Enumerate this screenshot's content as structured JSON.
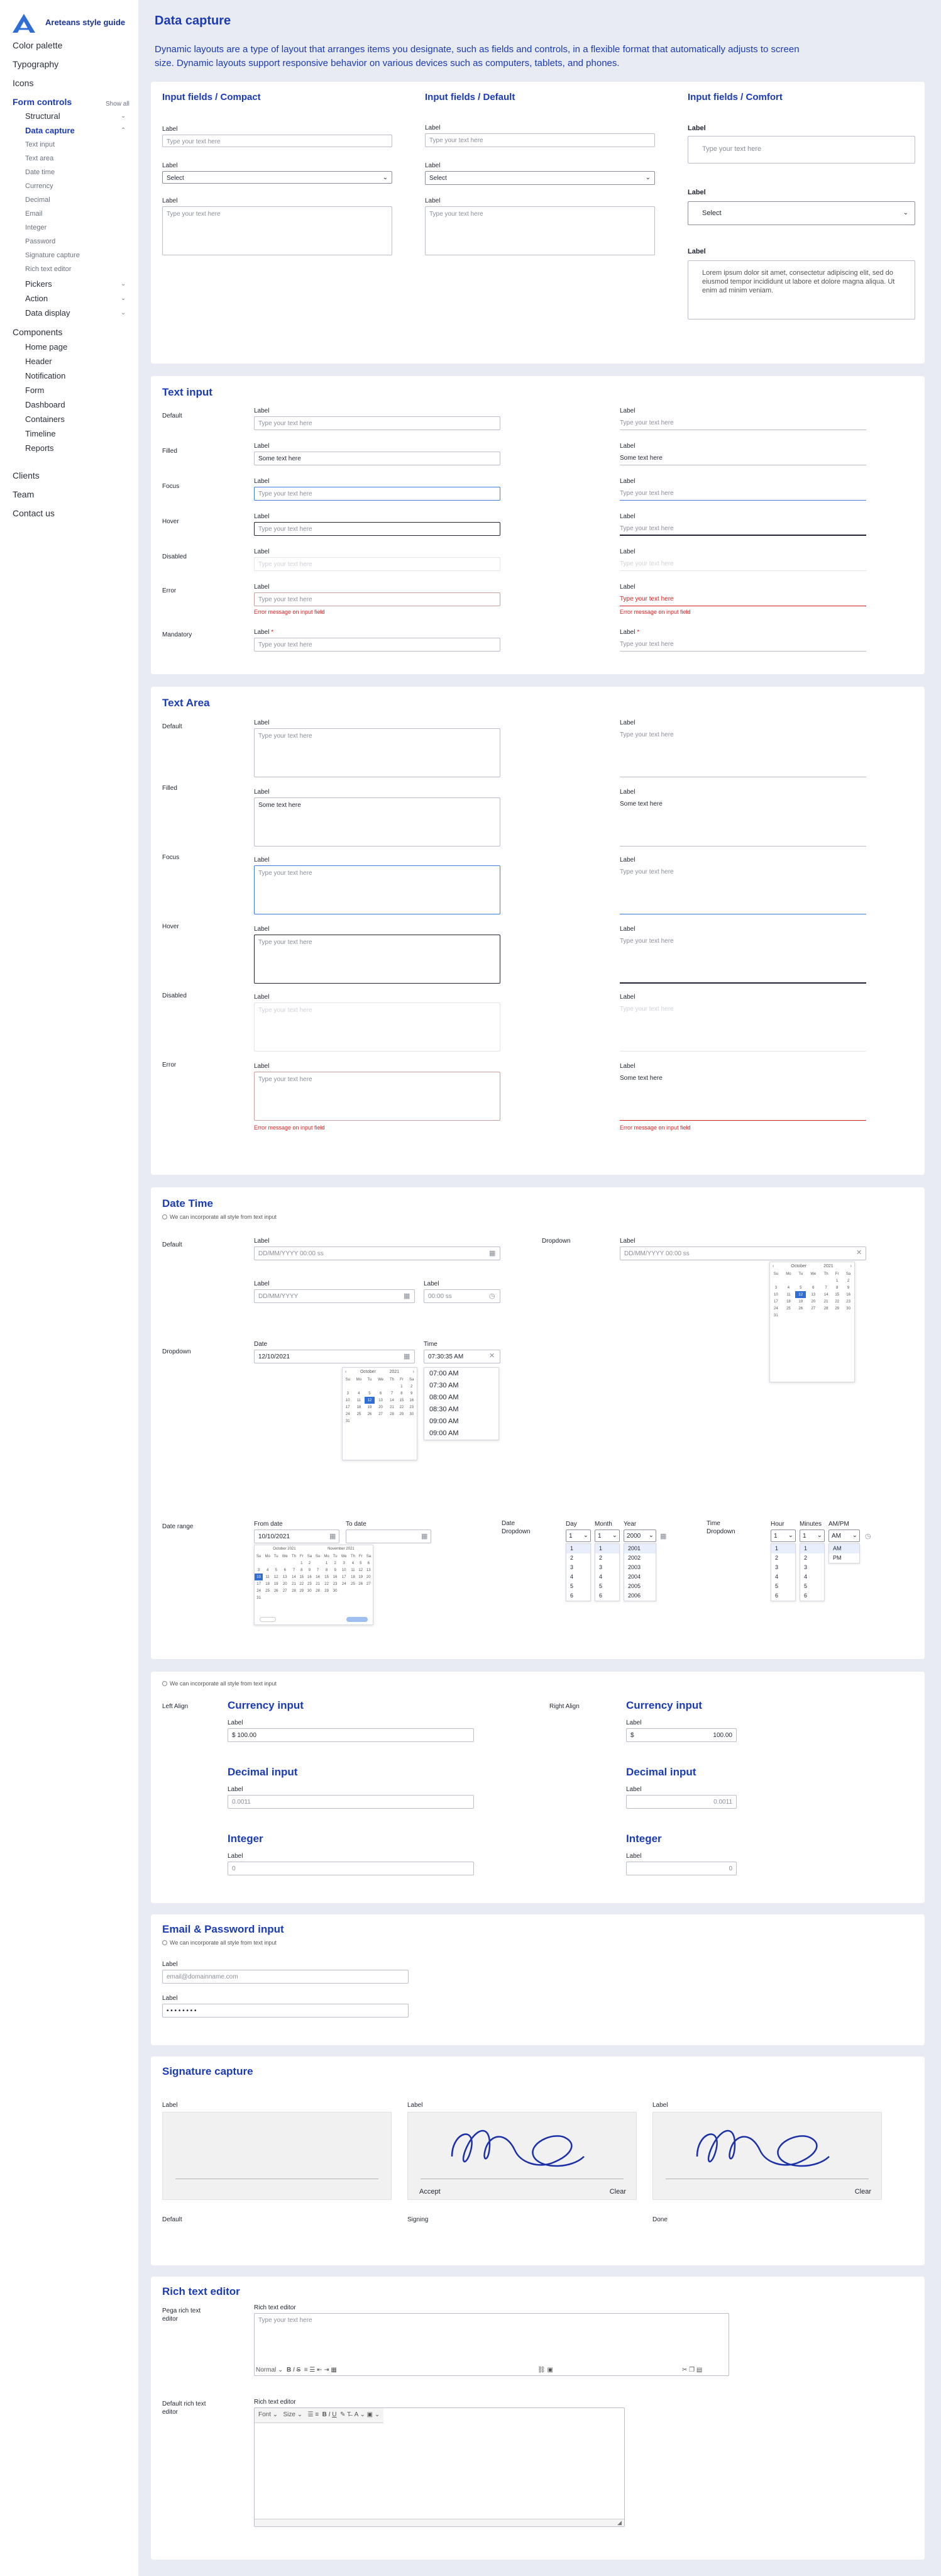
{
  "brand": {
    "name": "Areteans style guide"
  },
  "nav": {
    "show_all": "Show all",
    "items": [
      "Color palette",
      "Typography",
      "Icons",
      "Form controls",
      "Structural",
      "Data capture",
      "Text input",
      "Text area",
      "Date time",
      "Currency",
      "Decimal",
      "Email",
      "Integer",
      "Password",
      "Signature capture",
      "Rich text editor",
      "Pickers",
      "Action",
      "Data display",
      "Components",
      "Home page",
      "Header",
      "Notification",
      "Form",
      "Dashboard",
      "Containers",
      "Timeline",
      "Reports",
      "Clients",
      "Team",
      "Contact us"
    ]
  },
  "page": {
    "title": "Data capture",
    "description": "Dynamic layouts are a type of layout that arranges items you designate, such as fields and controls, in a flexible format that automatically adjusts to screen size. Dynamic layouts support responsive behavior on various devices such as computers, tablets, and phones."
  },
  "common": {
    "label": "Label",
    "placeholder": "Type your text here",
    "filled_text": "Some text here",
    "select": "Select",
    "error": "Error message on input field",
    "note": "We can incorporate all style from text input",
    "ta_lorem": "Lorem ipsum dolor sit amet, consectetur adipiscing elit, sed do eiusmod tempor incididunt ut labore et dolore magna aliqua. Ut enim ad minim veniam."
  },
  "layouts": {
    "compact": "Input fields / Compact",
    "default": "Input fields / Default",
    "comfort": "Input fields / Comfort"
  },
  "text_input": {
    "title": "Text input",
    "states": [
      "Default",
      "Filled",
      "Focus",
      "Hover",
      "Disabled",
      "Error",
      "Mandatory"
    ]
  },
  "text_area": {
    "title": "Text Area",
    "states": [
      "Default",
      "Filled",
      "Focus",
      "Hover",
      "Disabled",
      "Error"
    ]
  },
  "datetime": {
    "title": "Date Time",
    "default": "Default",
    "dropdown": "Dropdown",
    "datetime_ph": "DD/MM/YYYY  00:00 ss",
    "date_ph": "DD/MM/YYYY",
    "time_ph": "00:00 ss",
    "date_label": "Date",
    "time_label": "Time",
    "date_val": "12/10/2021",
    "time_val": "07:30:35 AM",
    "times": [
      "07:00  AM",
      "07:30  AM",
      "08:00  AM",
      "08:30  AM",
      "09:00  AM",
      "09:00  AM"
    ],
    "date_range": "Date range",
    "from_date": "From date",
    "to_date": "To date",
    "from_val": "10/10/2021",
    "date_dropdown": "Date Dropdown",
    "time_dropdown": "Time Dropdown",
    "day": "Day",
    "month": "Month",
    "year": "Year",
    "hour": "Hour",
    "minutes": "Minutes",
    "ampm": "AM/PM",
    "day_val": "1",
    "month_val": "1",
    "year_val": "2000",
    "hour_val": "1",
    "min_val": "1",
    "ampm_val": "AM",
    "years": [
      "2001",
      "2002",
      "2003",
      "2004",
      "2005",
      "2006"
    ],
    "nums": [
      "1",
      "2",
      "3",
      "4",
      "5",
      "6"
    ],
    "ampm_opts": [
      "AM",
      "PM"
    ],
    "cal_month": "October",
    "cal_year": "2021",
    "cal_month2": "November 2021",
    "cal_month1": "October 2021",
    "days": [
      "Su",
      "Mo",
      "Tu",
      "We",
      "Th",
      "Fr",
      "Sa"
    ]
  },
  "numbers": {
    "left_align": "Left Align",
    "right_align": "Right Align",
    "currency": "Currency input",
    "decimal": "Decimal input",
    "integer": "Integer",
    "cur_val_l": "$  100.00",
    "cur_val_r": "100.00",
    "dec_val": "0.0011",
    "int_val": "0"
  },
  "email": {
    "title": "Email & Password input",
    "email_val": "email@domainname.com",
    "password_val": "• • • • • • • •"
  },
  "signature": {
    "title": "Signature capture",
    "accept": "Accept",
    "clear": "Clear",
    "states": [
      "Default",
      "Signing",
      "Done"
    ]
  },
  "rich": {
    "title": "Rich text editor",
    "pega_label": "Pega rich text editor",
    "default_label": "Default rich text editor",
    "field_label": "Rich text editor",
    "normal": "Normal",
    "font": "Font",
    "size": "Size"
  }
}
